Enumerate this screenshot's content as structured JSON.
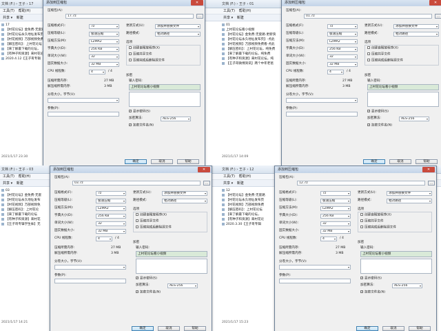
{
  "panels": [
    {
      "explorer": {
        "path": "文档 (F:) › 王子 › 17",
        "menu": [
          "工具(T)",
          "帮助(H)"
        ],
        "toolbar": [
          "共享 ▾",
          "新建"
        ],
        "items": [
          "17",
          "【村花论坛】金免费-无套路",
          "【村花论坛永久地址发布页",
          "【村花视频】万部视频免费",
          "【解压密码】：上村花论坛",
          "【来了解最下载的论坛，",
          "【有种子和资源】来村花论",
          "2020.4.12【王子哥专辑"
        ],
        "status": "2021/1/17 23:30"
      },
      "dialog": {
        "title": "添加到压缩包",
        "archive_label": "压缩包(A):",
        "archive_value": "17.7z",
        "format_label": "压缩格式(F):",
        "format_value": "7z",
        "level_label": "压缩等级(L):",
        "level_value": "极速压缩",
        "method_label": "压缩方法(M):",
        "method_value": "LZMA2",
        "dict_label": "字典大小(D):",
        "dict_value": "256 KB",
        "word_label": "单词大小(W):",
        "word_value": "32",
        "solid_label": "固实数据大小:",
        "solid_value": "32 MB",
        "cpu_label": "CPU 线程数:",
        "cpu_value": "4",
        "cpu_total": "/ 4",
        "mem_comp_label": "压缩所需内存:",
        "mem_comp_value": "27 MB",
        "mem_decomp_label": "解压缩所需内存:",
        "mem_decomp_value": "3 MB",
        "split_label": "分卷大小，字节(V):",
        "params_label": "参数(P):",
        "update_label": "更新方式(U):",
        "update_value": "添加并替换文件",
        "path_label": "路径模式:",
        "path_value": "相对路径",
        "options_label": "选项",
        "opt1": "创建自释放程序(X)",
        "opt2": "压缩共享文件",
        "opt3": "压缩完成后删除源文件",
        "encrypt_label": "加密",
        "pwd_label": "输入密码:",
        "pwd_value": "上村花论坛看小视频",
        "show_pwd": "显示密码(S)",
        "enc_method_label": "加密算法:",
        "enc_method_value": "AES-256",
        "enc_names": "加密文件名(N)",
        "ok": "确定",
        "cancel": "取消",
        "help": "帮助"
      }
    },
    {
      "explorer": {
        "path": "文档 (F:) › 王子 › 01",
        "menu": [
          "工具(T)",
          "帮助(H)"
        ],
        "toolbar": [
          "共享 ▾",
          "新建"
        ],
        "items": [
          "01",
          "上村花论坛看小视频",
          "【村花论坛】金免费-无套路-更新快",
          "【村花论坛永久地址发布页】-点此",
          "【村花视频】万部视频免费看-点此",
          "【解压密码】：上村花论坛，纯免费",
          "【来了解最下载的论坛，纯免费",
          "【有种子和资源】来村花论坛，纯",
          "【王子哥微博资讯】两个中年老爸"
        ],
        "status": "2021/1/17 14:09"
      },
      "dialog": {
        "title": "添加到压缩包",
        "archive_label": "压缩包(A):",
        "archive_value": "01.7z",
        "format_label": "压缩格式(F):",
        "format_value": "7z",
        "level_label": "压缩等级(L):",
        "level_value": "极速压缩",
        "method_label": "压缩方法(M):",
        "method_value": "LZMA2",
        "dict_label": "字典大小(D):",
        "dict_value": "256 KB",
        "word_label": "单词大小(W):",
        "word_value": "32",
        "solid_label": "固实数据大小:",
        "solid_value": "32 MB",
        "cpu_label": "CPU 线程数:",
        "cpu_value": "4",
        "cpu_total": "/ 4",
        "mem_comp_label": "压缩所需内存:",
        "mem_comp_value": "27 MB",
        "mem_decomp_label": "解压缩所需内存:",
        "mem_decomp_value": "3 MB",
        "split_label": "分卷大小，字节(V):",
        "params_label": "参数(P):",
        "update_label": "更新方式(U):",
        "update_value": "添加并替换文件",
        "path_label": "路径模式:",
        "path_value": "相对路径",
        "options_label": "选项",
        "opt1": "创建自释放程序(X)",
        "opt2": "压缩共享文件",
        "opt3": "压缩完成后删除源文件",
        "encrypt_label": "加密",
        "pwd_label": "输入密码:",
        "pwd_value": "上村花论坛看小视频",
        "show_pwd": "显示密码(S)",
        "enc_method_label": "加密算法:",
        "enc_method_value": "AES-256",
        "enc_names": "加密文件名(N)",
        "ok": "确定",
        "cancel": "取消",
        "help": "帮助"
      }
    },
    {
      "explorer": {
        "path": "文档 (F:) › 王子 › 03",
        "menu": [
          "工具(T)",
          "帮助(H)"
        ],
        "toolbar": [
          "共享 ▾",
          "新建"
        ],
        "items": [
          "03",
          "【村花论坛】金免费-无套",
          "【村花论坛永久地址发布",
          "【村花视频】万部视频免",
          "【解压密码】：上村花论",
          "【来了解最下载的论坛",
          "【有种子和资源】来村花",
          "【王子哥专辑学生妹】无"
        ],
        "status": "2021/1/17 14:21"
      },
      "dialog": {
        "title": "添加到压缩包",
        "archive_label": "压缩包(A):",
        "archive_value": "03.7z",
        "format_label": "压缩格式(F):",
        "format_value": "7z",
        "level_label": "压缩等级(L):",
        "level_value": "极速压缩",
        "method_label": "压缩方法(M):",
        "method_value": "LZMA2",
        "dict_label": "字典大小(D):",
        "dict_value": "256 KB",
        "word_label": "单词大小(W):",
        "word_value": "32",
        "solid_label": "固实数据大小:",
        "solid_value": "32 MB",
        "cpu_label": "CPU 线程数:",
        "cpu_value": "4",
        "cpu_total": "/ 4",
        "mem_comp_label": "压缩所需内存:",
        "mem_comp_value": "27 MB",
        "mem_decomp_label": "解压缩所需内存:",
        "mem_decomp_value": "3 MB",
        "split_label": "分卷大小，字节(V):",
        "params_label": "参数(P):",
        "update_label": "更新方式(U):",
        "update_value": "添加并替换文件",
        "path_label": "路径模式:",
        "path_value": "相对路径",
        "options_label": "选项",
        "opt1": "创建自释放程序(X)",
        "opt2": "压缩共享文件",
        "opt3": "压缩完成后删除源文件",
        "encrypt_label": "加密",
        "pwd_label": "输入密码:",
        "pwd_value": "上村花论坛看小视频",
        "show_pwd": "显示密码(S)",
        "enc_method_label": "加密算法:",
        "enc_method_value": "AES-256",
        "enc_names": "加密文件名(N)",
        "ok": "确定",
        "cancel": "取消",
        "help": "帮助"
      }
    },
    {
      "explorer": {
        "path": "文档 (F:) › 王子 › 12",
        "menu": [
          "工具(T)",
          "帮助(H)"
        ],
        "toolbar": [
          "共享 ▾",
          "新建"
        ],
        "items": [
          "12",
          "【村花论坛】金免费-无套路",
          "【村花论坛永久地址发布页",
          "【村花视频】万部视频免费",
          "【解压密码】：上村花论坛",
          "【来了解最下载的论坛，",
          "【有种子和资源】来村花论",
          "2020.3.30【王子哥专辑"
        ],
        "status": "2021/1/17 15:23"
      },
      "dialog": {
        "title": "添加到压缩包",
        "archive_label": "压缩包(A):",
        "archive_value": "12.7z",
        "format_label": "压缩格式(F):",
        "format_value": "7z",
        "level_label": "压缩等级(L):",
        "level_value": "极速压缩",
        "method_label": "压缩方法(M):",
        "method_value": "LZMA2",
        "dict_label": "字典大小(D):",
        "dict_value": "256 KB",
        "word_label": "单词大小(W):",
        "word_value": "32",
        "solid_label": "固实数据大小:",
        "solid_value": "32 MB",
        "cpu_label": "CPU 线程数:",
        "cpu_value": "4",
        "cpu_total": "/ 4",
        "mem_comp_label": "压缩所需内存:",
        "mem_comp_value": "27 MB",
        "mem_decomp_label": "解压缩所需内存:",
        "mem_decomp_value": "3 MB",
        "split_label": "分卷大小，字节(V):",
        "params_label": "参数(P):",
        "update_label": "更新方式(U):",
        "update_value": "添加并替换文件",
        "path_label": "路径模式:",
        "path_value": "相对路径",
        "options_label": "选项",
        "opt1": "创建自释放程序(X)",
        "opt2": "压缩共享文件",
        "opt3": "压缩完成后删除源文件",
        "encrypt_label": "加密",
        "pwd_label": "输入密码:",
        "pwd_value": "上村花论坛看小视频",
        "show_pwd": "显示密码(S)",
        "enc_method_label": "加密算法:",
        "enc_method_value": "AES-256",
        "enc_names": "加密文件名(N)",
        "ok": "确定",
        "cancel": "取消",
        "help": "帮助"
      }
    }
  ]
}
